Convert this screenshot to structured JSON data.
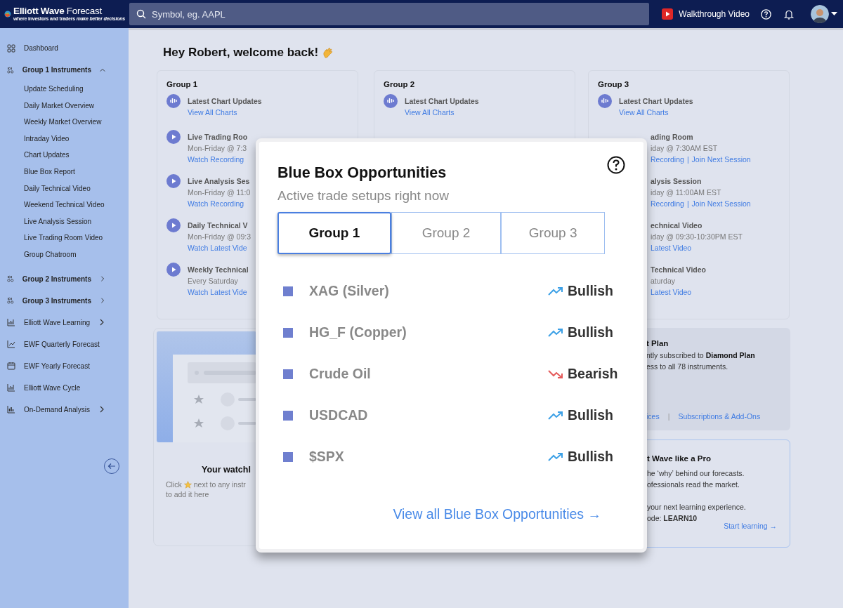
{
  "header": {
    "logo": {
      "name": "**Elliott Wave** Forecast",
      "tagline": "where investors and traders *make better decisions*"
    },
    "search": {
      "placeholder": "Symbol, eg. AAPL"
    },
    "walkthrough": "Walkthrough Video"
  },
  "sidebar": {
    "items": [
      {
        "kind": "link",
        "label": "Dashboard"
      },
      {
        "kind": "group",
        "label": "Group 1 Instruments",
        "expanded": true,
        "children": [
          {
            "label": "Update Scheduling"
          },
          {
            "label": "Daily Market Overview"
          },
          {
            "label": "Weekly Market Overview"
          },
          {
            "label": "Intraday Video"
          },
          {
            "label": "Chart Updates"
          },
          {
            "label": "Blue Box Report"
          },
          {
            "label": "Daily Technical Video"
          },
          {
            "label": "Weekend Technical Video"
          },
          {
            "label": "Live Analysis Session"
          },
          {
            "label": "Live Trading Room Video"
          },
          {
            "label": "Group Chatroom"
          }
        ]
      },
      {
        "kind": "group",
        "label": "Group 2 Instruments",
        "expanded": false
      },
      {
        "kind": "group",
        "label": "Group 3 Instruments",
        "expanded": false
      },
      {
        "kind": "menu",
        "label": "Elliott Wave Learning",
        "expanded": false
      },
      {
        "kind": "link",
        "label": "EWF Quarterly Forecast"
      },
      {
        "kind": "link",
        "label": "EWF Yearly Forecast"
      },
      {
        "kind": "link",
        "label": "Elliott Wave Cycle"
      },
      {
        "kind": "menu",
        "label": "On-Demand Analysis",
        "expanded": false
      }
    ]
  },
  "greeting": "Hey Robert, welcome back!",
  "groups": [
    {
      "title": "Group 1",
      "items": [
        {
          "kind": "chart",
          "title": "Latest Chart Updates",
          "links": [
            "View All Charts"
          ]
        },
        {
          "kind": "video",
          "title": "Live Trading Roo",
          "schedule": "Mon-Friday @ 7:3",
          "links": [
            "Watch Recording"
          ]
        },
        {
          "kind": "video",
          "title": "Live Analysis Ses",
          "schedule": "Mon-Friday @ 11:0",
          "links": [
            "Watch Recording"
          ]
        },
        {
          "kind": "video",
          "title": "Daily Technical V",
          "schedule": "Mon-Friday @ 09:3",
          "links": [
            "Watch Latest Vide"
          ]
        },
        {
          "kind": "video",
          "title": "Weekly Technical",
          "schedule": "Every Saturday",
          "links": [
            "Watch Latest Vide"
          ]
        }
      ]
    },
    {
      "title": "Group 2",
      "items": [
        {
          "kind": "chart",
          "title": "Latest Chart Updates",
          "links": [
            "View All Charts"
          ]
        }
      ]
    },
    {
      "title": "Group 3",
      "items": [
        {
          "kind": "chart",
          "title": "Latest Chart Updates",
          "links": [
            "View All Charts"
          ]
        },
        {
          "kind": "plain",
          "title": "ading Room",
          "schedule": "iday @ 7:30AM EST",
          "links": [
            "Recording",
            "Join Next Session"
          ],
          "separator": "|"
        },
        {
          "kind": "plain",
          "title": "alysis Session",
          "schedule": "iday @ 11:00AM EST",
          "links": [
            "Recording",
            "Join Next Session"
          ],
          "separator": "|"
        },
        {
          "kind": "plain",
          "title": "echnical Video",
          "schedule": "iday @ 09:30-10:30PM EST",
          "links": [
            "Latest Video"
          ]
        },
        {
          "kind": "plain",
          "title": "Technical Video",
          "schedule": "aturday",
          "links": [
            "Latest Video"
          ]
        }
      ]
    }
  ],
  "watchlist": {
    "title": "Your watchl",
    "hint_before": "Click",
    "hint_after": "next to any instr",
    "hint_line2": "to add it here"
  },
  "plan": {
    "title": "t Plan",
    "lines": [
      "ntly subscribed to **Diamond Plan**",
      "ess to all 78 instruments."
    ],
    "links": [
      "ices",
      "Subscriptions & Add-Ons"
    ],
    "separator": "|"
  },
  "learn": {
    "title": "t Wave like a Pro",
    "paragraphs": [
      [
        "he ‘why’ behind our forecasts.",
        "ofessionals read the market."
      ],
      [
        "your next learning experience.",
        "ode: **LEARN10**"
      ]
    ],
    "link": "Start learning →"
  },
  "modal": {
    "title": "Blue Box Opportunities",
    "subtitle": "Active trade setups right now",
    "tabs": [
      {
        "label": "Group 1",
        "selected": true
      },
      {
        "label": "Group 2",
        "selected": false
      },
      {
        "label": "Group 3",
        "selected": false
      }
    ],
    "rows": [
      {
        "name": "XAG (Silver)",
        "kind": "up",
        "label": "Bullish"
      },
      {
        "name": "HG_F (Copper)",
        "kind": "up",
        "label": "Bullish"
      },
      {
        "name": "Crude Oil",
        "kind": "down",
        "label": "Bearish"
      },
      {
        "name": "USDCAD",
        "kind": "up",
        "label": "Bullish"
      },
      {
        "name": "$SPX",
        "kind": "up",
        "label": "Bullish"
      }
    ],
    "link": "View all Blue Box Opportunities →"
  }
}
